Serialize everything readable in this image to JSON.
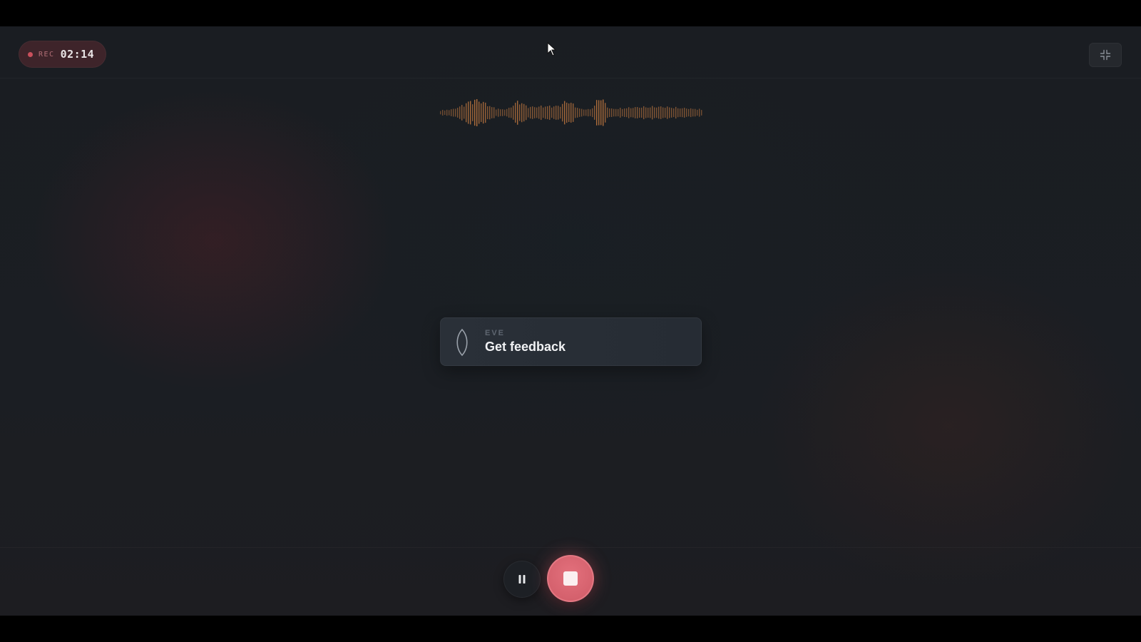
{
  "recorder": {
    "rec_label": "REC",
    "elapsed_time": "02:14",
    "is_recording": true
  },
  "prompt": {
    "agent_name": "EVE",
    "text": "Get feedback"
  },
  "icons": {
    "fullscreen": "collapse-fullscreen-icon",
    "pause": "pause-icon",
    "stop": "stop-icon",
    "agent": "agent-leaf-icon"
  },
  "colors": {
    "background": "#1b1e23",
    "record_accent": "#d9636f",
    "waveform": "#b8733e",
    "card": "#282e36",
    "primary_text": "#f1f2f4"
  }
}
